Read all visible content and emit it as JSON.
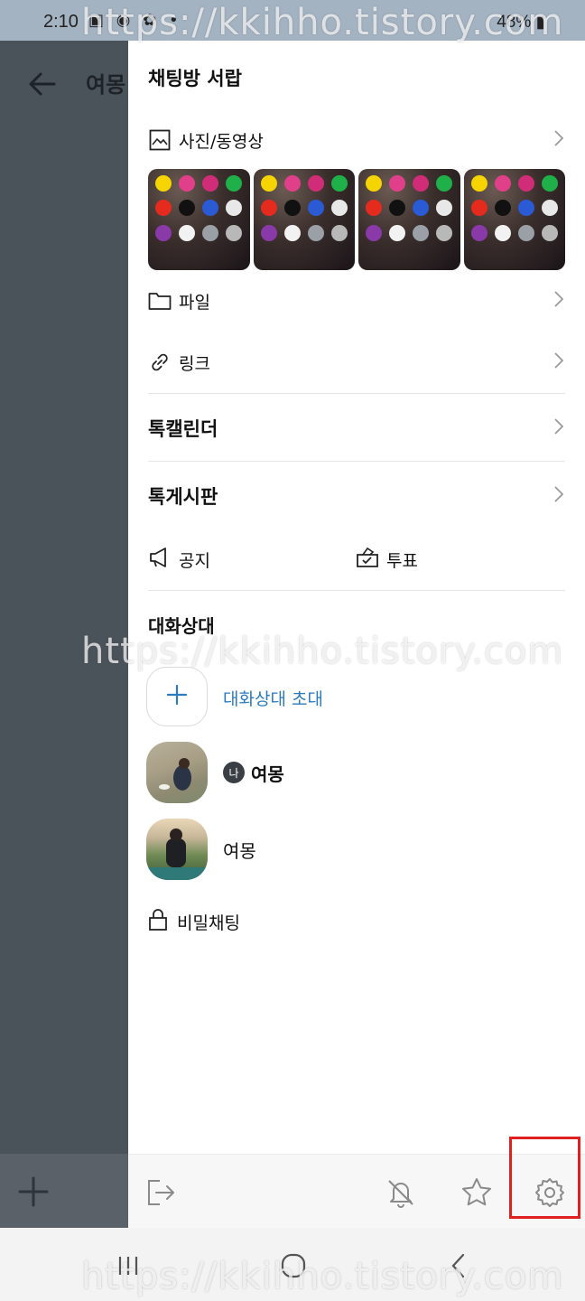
{
  "status_bar": {
    "time": "2:10",
    "battery": "48%"
  },
  "background_chat": {
    "title": "여몽"
  },
  "drawer": {
    "title": "채팅방 서랍",
    "media": {
      "label": "사진/동영상",
      "thumbnail_count": 4
    },
    "files": {
      "label": "파일"
    },
    "links": {
      "label": "링크"
    },
    "calendar": {
      "label": "톡캘린더"
    },
    "board": {
      "label": "톡게시판"
    },
    "notice": {
      "label": "공지"
    },
    "vote": {
      "label": "투표"
    },
    "members_section": {
      "title": "대화상대",
      "invite_label": "대화상대 초대",
      "members": [
        {
          "badge": "나",
          "name": "여몽"
        },
        {
          "name": "여몽"
        }
      ]
    },
    "secret_chat": {
      "label": "비밀채팅"
    }
  },
  "footer": {
    "icons": [
      "exit-icon",
      "mute-bell-icon",
      "star-icon",
      "settings-gear-icon"
    ]
  },
  "colors": {
    "link_blue": "#2b7bc0",
    "highlight_red": "#e02020",
    "status_bar_bg": "#a4b3c2"
  },
  "watermark": "https://kkihho.tistory.com"
}
